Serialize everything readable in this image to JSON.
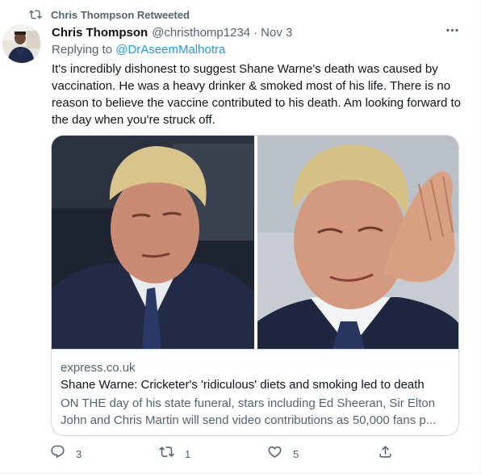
{
  "retweet_banner": {
    "text": "Chris Thompson Retweeted",
    "icon": "retweet-icon"
  },
  "tweet": {
    "author_name": "Chris Thompson",
    "author_handle": "@christhomp1234",
    "separator": "·",
    "date": "Nov 3",
    "reply_prefix": "Replying to",
    "reply_to": "@DrAseemMalhotra",
    "text": "It's incredibly dishonest to suggest Shane Warne's death was caused by vaccination. He was a heavy drinker & smoked most of his life. There is no reason to believe the vaccine contributed to his death. Am looking forward to the day when you're struck off.",
    "more_icon": "more-dots-icon"
  },
  "link_card": {
    "domain": "express.co.uk",
    "title": "Shane Warne: Cricketer's 'ridiculous' diets and smoking led to death",
    "description": "ON THE day of his state funeral, stars including Ed Sheeran, Sir Elton John and Chris Martin will send video contributions as 50,000 fans p..."
  },
  "actions": {
    "reply_count": "3",
    "retweet_count": "1",
    "like_count": "5"
  },
  "colors": {
    "text": "#0f1419",
    "secondary": "#536471",
    "link": "#1d9bf0",
    "border": "#cfd9de"
  }
}
